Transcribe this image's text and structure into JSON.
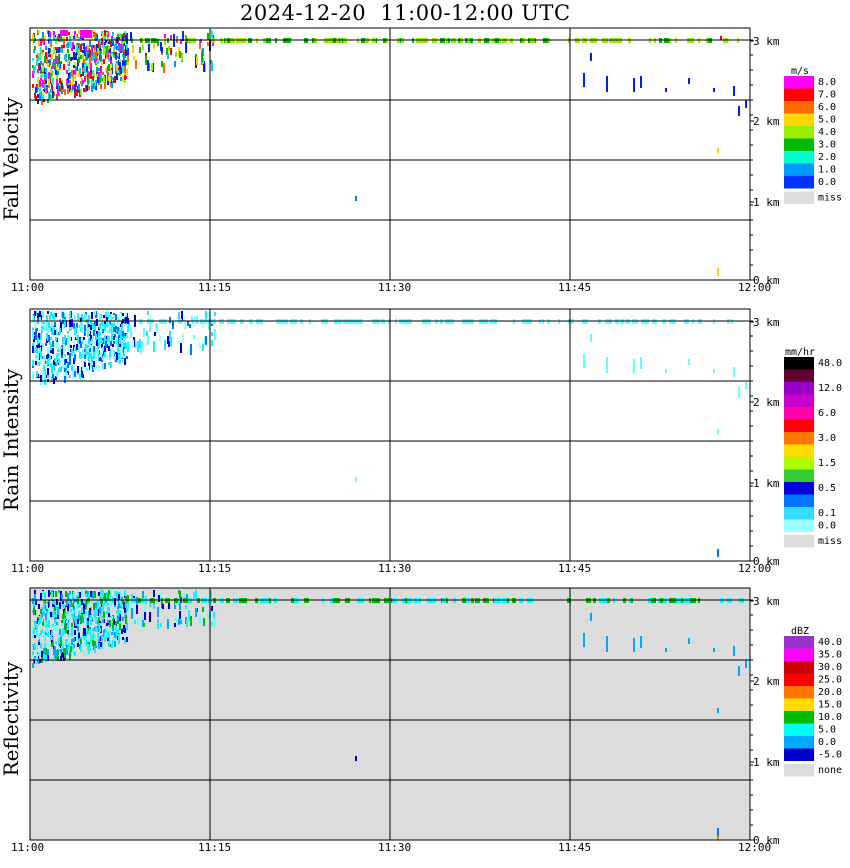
{
  "title": "2024-12-20  11:00-12:00 UTC",
  "time_ticks": [
    "11:00",
    "11:15",
    "11:30",
    "11:45",
    "12:00"
  ],
  "height_ticks": [
    "3 km",
    "2 km",
    "1 km",
    "0 km"
  ],
  "chart_data": [
    {
      "type": "heatmap",
      "panel": "Fall Velocity",
      "title": "Fall Velocity",
      "unit": "m/s",
      "background": "#ffffff",
      "miss_color": "#dcdcdc",
      "x_range": [
        "11:00",
        "12:00"
      ],
      "y_range_km": [
        0,
        3.2
      ],
      "legend": [
        {
          "label": "8.0",
          "color": "#ff00ff"
        },
        {
          "label": "7.0",
          "color": "#ff0000"
        },
        {
          "label": "6.0",
          "color": "#ff6a00"
        },
        {
          "label": "5.0",
          "color": "#ffd700"
        },
        {
          "label": "4.0",
          "color": "#99ee00"
        },
        {
          "label": "3.0",
          "color": "#00bb00"
        },
        {
          "label": "2.0",
          "color": "#00ffcc"
        },
        {
          "label": "1.0",
          "color": "#0099ff"
        },
        {
          "label": "0.0",
          "color": "#0033ff"
        },
        {
          "label": "miss",
          "color": "#dcdcdc"
        }
      ],
      "scale": [
        "#0022ee",
        "#0033ff",
        "#0099ff",
        "#00ccff",
        "#00ffcc",
        "#00bb00",
        "#99ee00",
        "#ffd700",
        "#ff6a00",
        "#ff0000",
        "#ff00ff"
      ],
      "notes": "Dense echoes 11:00-11:08 between 2.3 and 3.2 km; melting/bright band near 3.0 km across the hour; scattered returns after 11:45."
    },
    {
      "type": "heatmap",
      "panel": "Rain Intensity",
      "title": "Rain Intensity",
      "unit": "mm/hr",
      "background": "#ffffff",
      "x_range": [
        "11:00",
        "12:00"
      ],
      "y_range_km": [
        0,
        3.2
      ],
      "legend": [
        {
          "label": "48.0",
          "color": "#000000"
        },
        {
          "label": "",
          "color": "#660033"
        },
        {
          "label": "12.0",
          "color": "#9900cc"
        },
        {
          "label": "",
          "color": "#cc00cc"
        },
        {
          "label": "6.0",
          "color": "#ff00aa"
        },
        {
          "label": "",
          "color": "#ff0000"
        },
        {
          "label": "3.0",
          "color": "#ff7700"
        },
        {
          "label": "",
          "color": "#ffdd00"
        },
        {
          "label": "1.5",
          "color": "#aaff00"
        },
        {
          "label": "",
          "color": "#33cc33"
        },
        {
          "label": "0.5",
          "color": "#0000dd"
        },
        {
          "label": "",
          "color": "#0077ff"
        },
        {
          "label": "0.1",
          "color": "#33ddff"
        },
        {
          "label": "0.0",
          "color": "#99ffff"
        },
        {
          "label": "miss",
          "color": "#dcdcdc"
        }
      ],
      "scale": [
        "#aaffff",
        "#66ffff",
        "#00ffff",
        "#33ddff",
        "#0077ff",
        "#0000dd"
      ],
      "notes": "Light intensities 0.0-0.5 mm/hr concentrated 11:00-11:08 above 2.3 km."
    },
    {
      "type": "heatmap",
      "panel": "Reflectivity",
      "title": "Reflectivity",
      "unit": "dBZ",
      "background": "#dcdcdc",
      "x_range": [
        "11:00",
        "12:00"
      ],
      "y_range_km": [
        0,
        3.2
      ],
      "legend": [
        {
          "label": "40.0",
          "color": "#9933cc"
        },
        {
          "label": "35.0",
          "color": "#ff00ff"
        },
        {
          "label": "30.0",
          "color": "#cc0000"
        },
        {
          "label": "25.0",
          "color": "#ff0000"
        },
        {
          "label": "20.0",
          "color": "#ff7700"
        },
        {
          "label": "15.0",
          "color": "#ffdd00"
        },
        {
          "label": "10.0",
          "color": "#00bb00"
        },
        {
          "label": "5.0",
          "color": "#00ffff"
        },
        {
          "label": "0.0",
          "color": "#00aaff"
        },
        {
          "label": "-5.0",
          "color": "#0000cc"
        },
        {
          "label": "none",
          "color": "#dcdcdc"
        }
      ],
      "scale": [
        "#66ffff",
        "#00ffff",
        "#33ddff",
        "#00aaff",
        "#00bb00",
        "#0000cc"
      ],
      "notes": "Weak reflectivity (-5 to 10 dBZ) in the upper region early in the hour and along the ~3 km layer."
    }
  ]
}
